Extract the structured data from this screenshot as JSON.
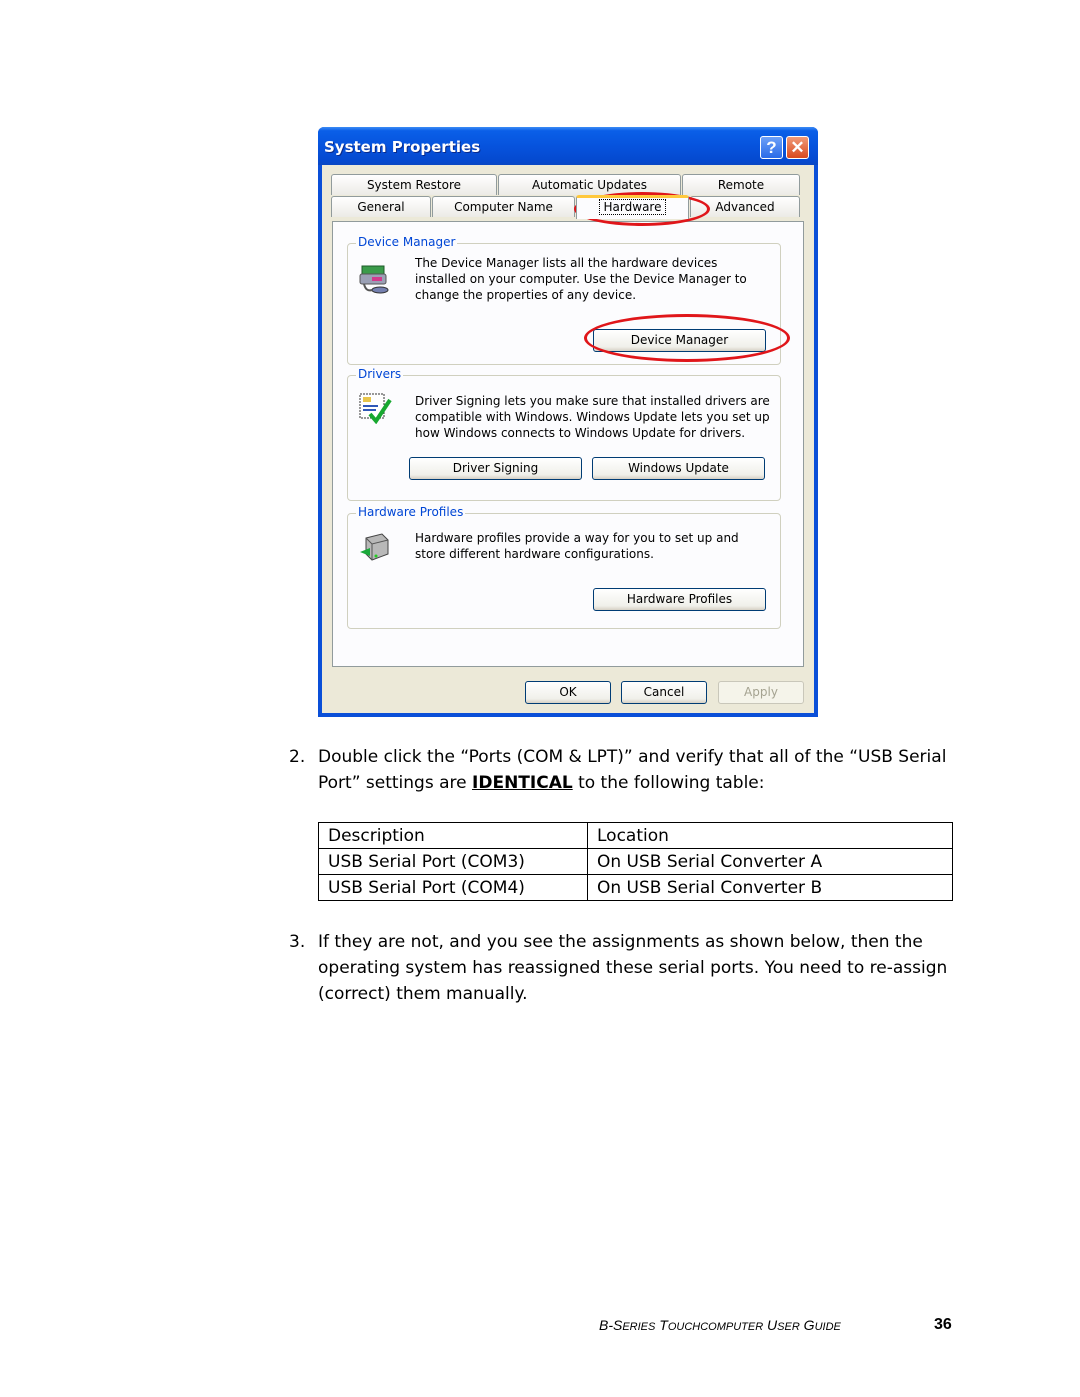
{
  "window": {
    "title": "System Properties",
    "help_icon": "question-mark",
    "close_icon": "x",
    "tabs_row1": [
      {
        "label": "System Restore"
      },
      {
        "label": "Automatic Updates"
      },
      {
        "label": "Remote"
      }
    ],
    "tabs_row2": [
      {
        "label": "General"
      },
      {
        "label": "Computer Name"
      },
      {
        "label": "Hardware",
        "active": true
      },
      {
        "label": "Advanced"
      }
    ],
    "groups": {
      "device_manager": {
        "label": "Device Manager",
        "text": "The Device Manager lists all the hardware devices installed on your computer. Use the Device Manager to change the properties of any device.",
        "button": "Device Manager",
        "icon": "device-manager-icon"
      },
      "drivers": {
        "label": "Drivers",
        "text": "Driver Signing lets you make sure that installed drivers are compatible with Windows. Windows Update lets you set up how Windows connects to Windows Update for drivers.",
        "button_signing": "Driver Signing",
        "button_update": "Windows Update",
        "icon": "driver-signing-icon"
      },
      "hardware_profiles": {
        "label": "Hardware Profiles",
        "text": "Hardware profiles provide a way for you to set up and store different hardware configurations.",
        "button": "Hardware Profiles",
        "icon": "hardware-profiles-icon"
      }
    },
    "footer_buttons": {
      "ok": "OK",
      "cancel": "Cancel",
      "apply": "Apply"
    },
    "highlight_color": "#e0161a"
  },
  "doc": {
    "step2_num": "2.",
    "step2_part1": "Double click the “Ports (COM & LPT)” and verify that all of the “USB Serial Port” settings are ",
    "step2_emph": "IDENTICAL",
    "step2_part2": " to the following table:",
    "table": {
      "headers": [
        "Description",
        "Location"
      ],
      "rows": [
        [
          "USB Serial Port (COM3)",
          "On USB Serial Converter A"
        ],
        [
          "USB Serial Port (COM4)",
          "On USB Serial Converter B"
        ]
      ]
    },
    "step3_num": "3.",
    "step3_text": "If they are not, and you see the assignments as shown below, then the operating system has reassigned these serial ports. You need to re-assign (correct) them manually."
  },
  "footer": {
    "guide_title_b": "B-S",
    "guide_title_b_sc": "ERIES",
    "guide_title_t": " T",
    "guide_title_t_sc": "OUCHCOMPUTER",
    "guide_title_u": " U",
    "guide_title_u_sc": "SER",
    "guide_title_g": " G",
    "guide_title_g_sc": "UIDE",
    "page_number": "36"
  }
}
